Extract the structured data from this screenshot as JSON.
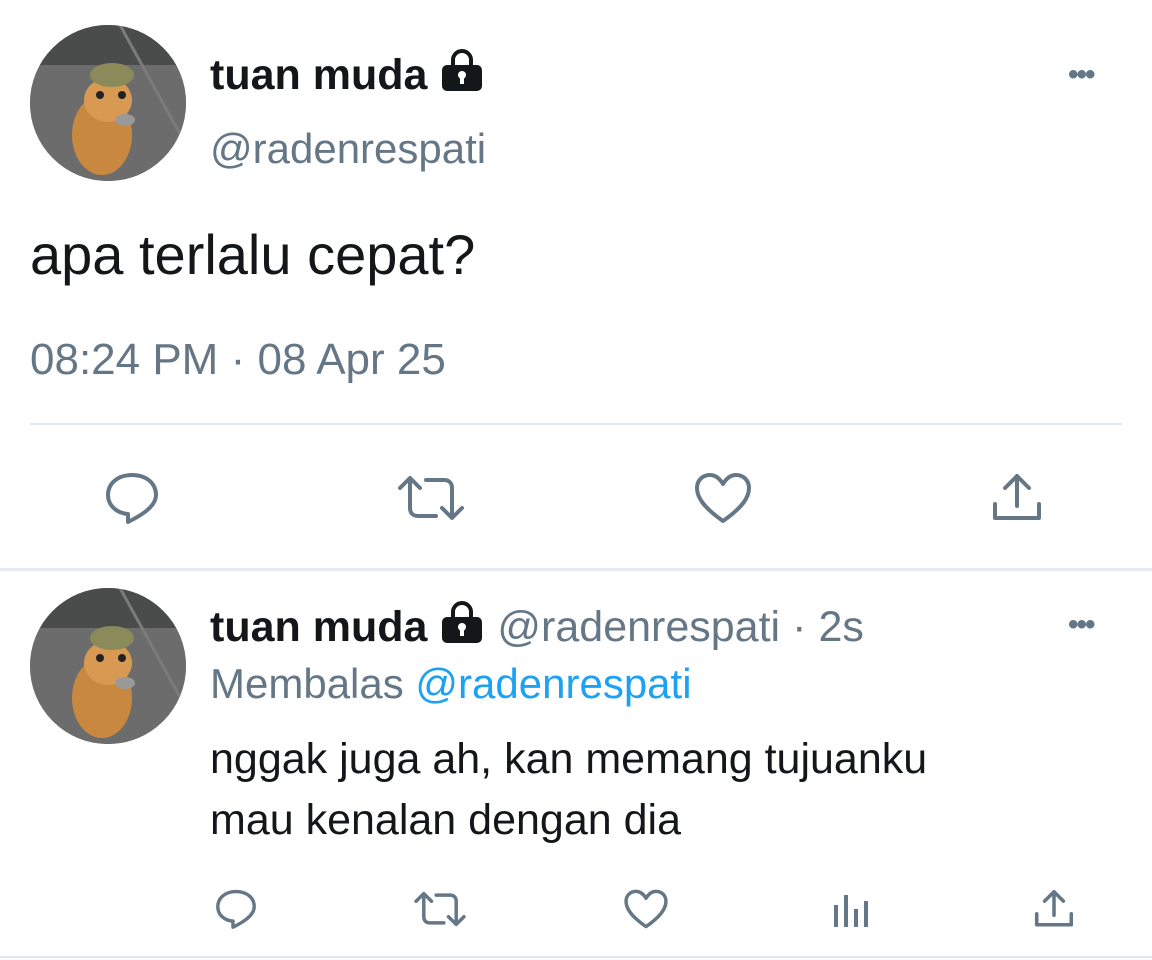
{
  "main_tweet": {
    "display_name": "tuan muda",
    "handle": "@radenrespati",
    "text": "apa terlalu cepat?",
    "time": "08:24 PM",
    "separator": "·",
    "date": "08 Apr 25",
    "more_label": "•••",
    "actions": [
      "reply-icon",
      "retweet-icon",
      "like-icon",
      "share-icon"
    ],
    "protected_icon": "lock-icon"
  },
  "reply_tweet": {
    "display_name": "tuan muda",
    "handle": "@radenrespati",
    "dot": "·",
    "age": "2s",
    "replying_label": "Membalas",
    "replying_to": "@radenrespati",
    "text_line1": "nggak juga ah, kan memang tujuanku",
    "text_line2": "mau kenalan dengan dia",
    "more_label": "•••",
    "actions": [
      "reply-icon",
      "retweet-icon",
      "like-icon",
      "analytics-icon",
      "share-icon"
    ],
    "protected_icon": "lock-icon"
  },
  "colors": {
    "text": "#14171a",
    "secondary": "#657786",
    "link": "#1da1f2",
    "divider": "#e1e8ed"
  }
}
